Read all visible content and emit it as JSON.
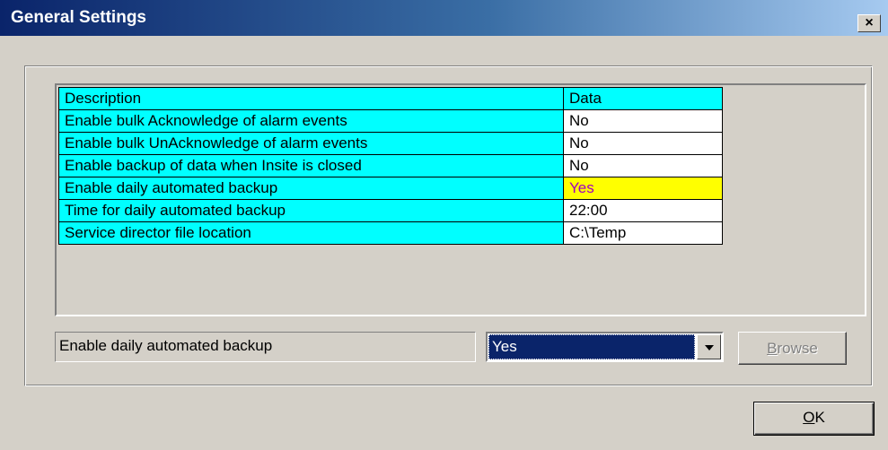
{
  "window": {
    "title": "General Settings",
    "close_label": "×"
  },
  "grid": {
    "header": {
      "description": "Description",
      "data": "Data"
    },
    "rows": [
      {
        "description": "Enable bulk Acknowledge of alarm events",
        "data": "No"
      },
      {
        "description": "Enable bulk UnAcknowledge of alarm events",
        "data": "No"
      },
      {
        "description": "Enable backup of data when Insite is closed",
        "data": "No"
      },
      {
        "description": "Enable daily automated backup",
        "data": "Yes",
        "selected": true
      },
      {
        "description": "Time for daily automated backup",
        "data": "22:00"
      },
      {
        "description": "Service director file location",
        "data": "C:\\Temp"
      }
    ]
  },
  "editor": {
    "field_label": "Enable daily automated backup",
    "selected_value": "Yes"
  },
  "buttons": {
    "browse_mnemonic": "B",
    "browse_rest": "rowse",
    "browse_enabled": false,
    "ok_mnemonic": "O",
    "ok_rest": "K"
  },
  "colors": {
    "grid_cell": "#00ffff",
    "selected_cell": "#ffff00",
    "selected_text": "#a000c0",
    "titlebar_start": "#0a246a"
  },
  "icons": {
    "close": "close-icon",
    "dropdown": "chevron-down-icon"
  }
}
